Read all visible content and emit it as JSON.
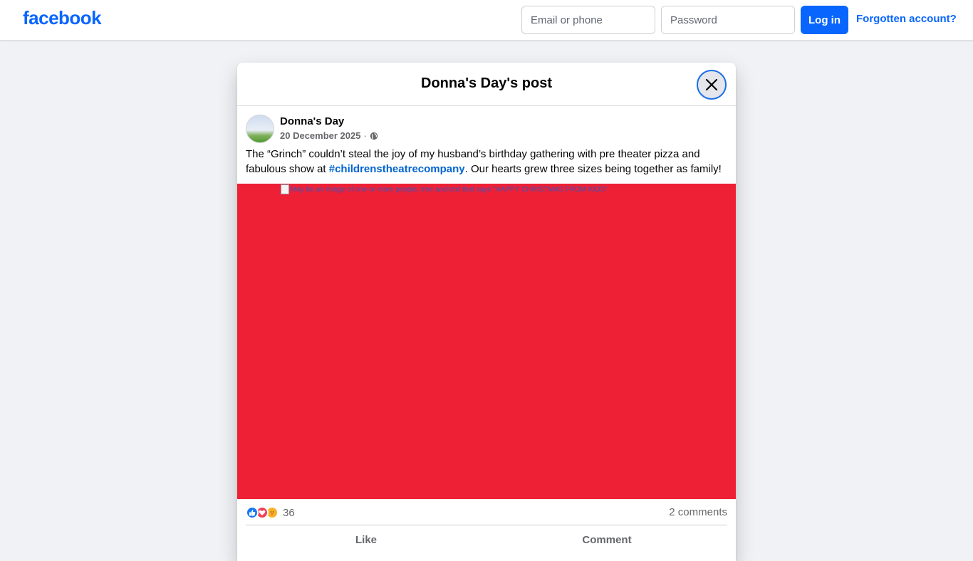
{
  "header": {
    "logo": "facebook",
    "email_placeholder": "Email or phone",
    "password_placeholder": "Password",
    "login_label": "Log in",
    "forgot_label": "Forgotten account?"
  },
  "modal": {
    "title": "Donna's Day's post"
  },
  "post": {
    "author": "Donna's Day",
    "date": "20 December 2025",
    "separator": "·",
    "text_before": "The “Grinch” couldn’t steal the joy of my husband’s birthday gathering with pre theater pizza and fabulous show at ",
    "hashtag": "#childrenstheatrecompany",
    "text_after": ". Our hearts grew three sizes being together as family!",
    "image_alt": "May be an image of one or more people, tree and text that says \"HAPPY CHRISTMAS FROM KIDS\"",
    "reaction_count": "36",
    "comments_label": "2 comments",
    "like_label": "Like",
    "comment_label": "Comment"
  },
  "colors": {
    "brand": "#0866ff",
    "image_background": "#ee2036",
    "link": "#0064d1"
  },
  "icons": [
    "close-icon",
    "globe-icon",
    "like-reaction-icon",
    "love-reaction-icon",
    "care-reaction-icon"
  ]
}
